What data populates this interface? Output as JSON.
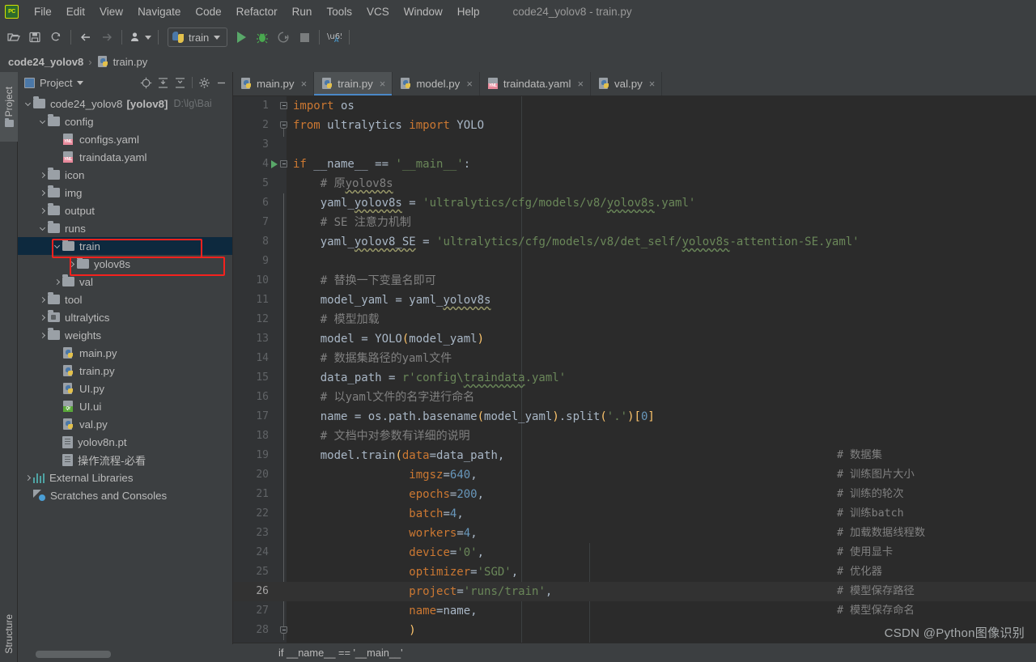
{
  "window": {
    "title": "code24_yolov8 - train.py",
    "logo": "pycharm-logo"
  },
  "menubar": {
    "items": [
      {
        "label": "File"
      },
      {
        "label": "Edit"
      },
      {
        "label": "View"
      },
      {
        "label": "Navigate"
      },
      {
        "label": "Code"
      },
      {
        "label": "Refactor"
      },
      {
        "label": "Run"
      },
      {
        "label": "Tools"
      },
      {
        "label": "VCS"
      },
      {
        "label": "Window"
      },
      {
        "label": "Help"
      }
    ]
  },
  "toolbar": {
    "run_config": "train",
    "icons": [
      "open-folder-icon",
      "save-icon",
      "sync-icon",
      "back-arrow-icon",
      "forward-arrow-icon",
      "profile-icon",
      "run-icon",
      "debug-icon",
      "run-coverage-icon",
      "stop-icon",
      "translate-icon"
    ]
  },
  "navbar": {
    "project": "code24_yolov8",
    "separator": "›",
    "file": "train.py"
  },
  "left_strip": {
    "project_tab": "Project",
    "structure_tab": "Structure"
  },
  "project_panel": {
    "title": "Project",
    "header_icons": [
      "locate-icon",
      "expand-all-icon",
      "collapse-all-icon",
      "gear-icon",
      "hide-icon"
    ],
    "tree": [
      {
        "depth": 0,
        "arrow": "down",
        "icon": "folder",
        "label": "code24_yolov8",
        "bold_suffix": "[yolov8]",
        "path": "D:\\lg\\Bai"
      },
      {
        "depth": 1,
        "arrow": "down",
        "icon": "folder",
        "label": "config"
      },
      {
        "depth": 2,
        "arrow": "none",
        "icon": "yaml",
        "label": "configs.yaml"
      },
      {
        "depth": 2,
        "arrow": "none",
        "icon": "yaml",
        "label": "traindata.yaml"
      },
      {
        "depth": 1,
        "arrow": "right",
        "icon": "folder",
        "label": "icon"
      },
      {
        "depth": 1,
        "arrow": "right",
        "icon": "folder",
        "label": "img"
      },
      {
        "depth": 1,
        "arrow": "right",
        "icon": "folder",
        "label": "output"
      },
      {
        "depth": 1,
        "arrow": "down",
        "icon": "folder",
        "label": "runs"
      },
      {
        "depth": 2,
        "arrow": "down",
        "icon": "folder",
        "label": "train",
        "selected": true,
        "highlight": true
      },
      {
        "depth": 3,
        "arrow": "right",
        "icon": "folder",
        "label": "yolov8s",
        "highlight": true
      },
      {
        "depth": 2,
        "arrow": "right",
        "icon": "folder",
        "label": "val"
      },
      {
        "depth": 1,
        "arrow": "right",
        "icon": "folder",
        "label": "tool"
      },
      {
        "depth": 1,
        "arrow": "right",
        "icon": "module",
        "label": "ultralytics"
      },
      {
        "depth": 1,
        "arrow": "right",
        "icon": "folder",
        "label": "weights"
      },
      {
        "depth": 2,
        "arrow": "none",
        "icon": "py",
        "label": "main.py"
      },
      {
        "depth": 2,
        "arrow": "none",
        "icon": "py",
        "label": "train.py"
      },
      {
        "depth": 2,
        "arrow": "none",
        "icon": "py",
        "label": "UI.py"
      },
      {
        "depth": 2,
        "arrow": "none",
        "icon": "qt",
        "label": "UI.ui"
      },
      {
        "depth": 2,
        "arrow": "none",
        "icon": "py",
        "label": "val.py"
      },
      {
        "depth": 2,
        "arrow": "none",
        "icon": "file",
        "label": "yolov8n.pt"
      },
      {
        "depth": 2,
        "arrow": "none",
        "icon": "file",
        "label": "操作流程-必看"
      },
      {
        "depth": 0,
        "arrow": "right",
        "icon": "lib",
        "label": "External Libraries"
      },
      {
        "depth": 0,
        "arrow": "none",
        "icon": "scratch",
        "label": "Scratches and Consoles"
      }
    ]
  },
  "editor": {
    "tabs": [
      {
        "label": "main.py",
        "icon": "py",
        "active": false
      },
      {
        "label": "train.py",
        "icon": "py",
        "active": true
      },
      {
        "label": "model.py",
        "icon": "py",
        "active": false
      },
      {
        "label": "traindata.yaml",
        "icon": "yaml",
        "active": false
      },
      {
        "label": "val.py",
        "icon": "py",
        "active": false
      }
    ],
    "close_glyph": "×",
    "breadcrumb": "if __name__ == '__main__'",
    "current_line": 26,
    "lines": [
      {
        "n": 1,
        "tokens": [
          {
            "t": "import",
            "c": "kw"
          },
          {
            "t": " os",
            "c": "id"
          }
        ],
        "fold": "open"
      },
      {
        "n": 2,
        "tokens": [
          {
            "t": "from",
            "c": "kw"
          },
          {
            "t": " ultralytics ",
            "c": "id"
          },
          {
            "t": "import",
            "c": "kw"
          },
          {
            "t": " YOLO",
            "c": "id"
          }
        ],
        "fold": "end"
      },
      {
        "n": 3,
        "tokens": []
      },
      {
        "n": 4,
        "tokens": [
          {
            "t": "if",
            "c": "kw"
          },
          {
            "t": " __name__ == ",
            "c": "id"
          },
          {
            "t": "'__main__'",
            "c": "str"
          },
          {
            "t": ":",
            "c": "id"
          }
        ],
        "fold": "open",
        "runmark": true
      },
      {
        "n": 5,
        "tokens": [
          {
            "t": "    # 原",
            "c": "cmt"
          },
          {
            "t": "yolov8s",
            "c": "cmt squig-g"
          }
        ]
      },
      {
        "n": 6,
        "tokens": [
          {
            "t": "    yaml_",
            "c": "id"
          },
          {
            "t": "yolov8s",
            "c": "id squig-g"
          },
          {
            "t": " = ",
            "c": "id"
          },
          {
            "t": "'ultralytics/cfg/models/v8/",
            "c": "str"
          },
          {
            "t": "yolov8s",
            "c": "str squig"
          },
          {
            "t": ".yaml'",
            "c": "str"
          }
        ]
      },
      {
        "n": 7,
        "tokens": [
          {
            "t": "    # SE 注意力机制",
            "c": "cmt"
          }
        ]
      },
      {
        "n": 8,
        "tokens": [
          {
            "t": "    yaml_",
            "c": "id"
          },
          {
            "t": "yolov8_SE",
            "c": "id squig-g"
          },
          {
            "t": " = ",
            "c": "id"
          },
          {
            "t": "'ultralytics/cfg/models/v8/det_self/",
            "c": "str"
          },
          {
            "t": "yolov8s",
            "c": "str squig"
          },
          {
            "t": "-attention-SE.yaml'",
            "c": "str"
          }
        ]
      },
      {
        "n": 9,
        "tokens": []
      },
      {
        "n": 10,
        "tokens": [
          {
            "t": "    # 替换一下变量名即可",
            "c": "cmt"
          }
        ]
      },
      {
        "n": 11,
        "tokens": [
          {
            "t": "    model_yaml = yaml_",
            "c": "id"
          },
          {
            "t": "yolov8s",
            "c": "id squig-g"
          }
        ]
      },
      {
        "n": 12,
        "tokens": [
          {
            "t": "    # 模型加载",
            "c": "cmt"
          }
        ]
      },
      {
        "n": 13,
        "tokens": [
          {
            "t": "    model = YOLO",
            "c": "id"
          },
          {
            "t": "(",
            "c": "fn"
          },
          {
            "t": "model_yaml",
            "c": "id"
          },
          {
            "t": ")",
            "c": "fn"
          }
        ]
      },
      {
        "n": 14,
        "tokens": [
          {
            "t": "    # 数据集路径的yaml文件",
            "c": "cmt"
          }
        ]
      },
      {
        "n": 15,
        "tokens": [
          {
            "t": "    data_path = ",
            "c": "id"
          },
          {
            "t": "r'config\\",
            "c": "str"
          },
          {
            "t": "traindata",
            "c": "str squig"
          },
          {
            "t": ".yaml'",
            "c": "str"
          }
        ]
      },
      {
        "n": 16,
        "tokens": [
          {
            "t": "    # 以yaml文件的名字进行命名",
            "c": "cmt"
          }
        ]
      },
      {
        "n": 17,
        "tokens": [
          {
            "t": "    name = os.path.basename",
            "c": "id"
          },
          {
            "t": "(",
            "c": "fn"
          },
          {
            "t": "model_yaml",
            "c": "id"
          },
          {
            "t": ")",
            "c": "fn"
          },
          {
            "t": ".split",
            "c": "id"
          },
          {
            "t": "(",
            "c": "fn"
          },
          {
            "t": "'.'",
            "c": "str"
          },
          {
            "t": ")",
            "c": "fn"
          },
          {
            "t": "[",
            "c": "fn"
          },
          {
            "t": "0",
            "c": "num2"
          },
          {
            "t": "]",
            "c": "fn"
          }
        ]
      },
      {
        "n": 18,
        "tokens": [
          {
            "t": "    # 文档中对参数有详细的说明",
            "c": "cmt"
          }
        ]
      },
      {
        "n": 19,
        "tokens": [
          {
            "t": "    model.train",
            "c": "id"
          },
          {
            "t": "(",
            "c": "fn"
          },
          {
            "t": "data",
            "c": "kwarg"
          },
          {
            "t": "=data_path",
            "c": "id"
          },
          {
            "t": ",",
            "c": "id"
          }
        ],
        "comment": "# 数据集"
      },
      {
        "n": 20,
        "tokens": [
          {
            "t": "                 ",
            "c": "id"
          },
          {
            "t": "imgsz",
            "c": "kwarg"
          },
          {
            "t": "=",
            "c": "id"
          },
          {
            "t": "640",
            "c": "num2"
          },
          {
            "t": ",",
            "c": "id"
          }
        ],
        "comment": "# 训练图片大小"
      },
      {
        "n": 21,
        "tokens": [
          {
            "t": "                 ",
            "c": "id"
          },
          {
            "t": "epochs",
            "c": "kwarg"
          },
          {
            "t": "=",
            "c": "id"
          },
          {
            "t": "200",
            "c": "num2"
          },
          {
            "t": ",",
            "c": "id"
          }
        ],
        "comment": "# 训练的轮次"
      },
      {
        "n": 22,
        "tokens": [
          {
            "t": "                 ",
            "c": "id"
          },
          {
            "t": "batch",
            "c": "kwarg"
          },
          {
            "t": "=",
            "c": "id"
          },
          {
            "t": "4",
            "c": "num2"
          },
          {
            "t": ",",
            "c": "id"
          }
        ],
        "comment": "# 训练batch"
      },
      {
        "n": 23,
        "tokens": [
          {
            "t": "                 ",
            "c": "id"
          },
          {
            "t": "workers",
            "c": "kwarg"
          },
          {
            "t": "=",
            "c": "id"
          },
          {
            "t": "4",
            "c": "num2"
          },
          {
            "t": ",",
            "c": "id"
          }
        ],
        "comment": "# 加载数据线程数"
      },
      {
        "n": 24,
        "tokens": [
          {
            "t": "                 ",
            "c": "id"
          },
          {
            "t": "device",
            "c": "kwarg"
          },
          {
            "t": "=",
            "c": "id"
          },
          {
            "t": "'0'",
            "c": "str"
          },
          {
            "t": ",",
            "c": "id"
          }
        ],
        "comment": "# 使用显卡"
      },
      {
        "n": 25,
        "tokens": [
          {
            "t": "                 ",
            "c": "id"
          },
          {
            "t": "optimizer",
            "c": "kwarg"
          },
          {
            "t": "=",
            "c": "id"
          },
          {
            "t": "'SGD'",
            "c": "str"
          },
          {
            "t": ",",
            "c": "id"
          }
        ],
        "comment": "# 优化器"
      },
      {
        "n": 26,
        "tokens": [
          {
            "t": "                 ",
            "c": "id"
          },
          {
            "t": "project",
            "c": "kwarg"
          },
          {
            "t": "=",
            "c": "id"
          },
          {
            "t": "'runs/train'",
            "c": "str"
          },
          {
            "t": ",",
            "c": "id"
          }
        ],
        "comment": "# 模型保存路径",
        "current": true
      },
      {
        "n": 27,
        "tokens": [
          {
            "t": "                 ",
            "c": "id"
          },
          {
            "t": "name",
            "c": "kwarg"
          },
          {
            "t": "=name",
            "c": "id"
          },
          {
            "t": ",",
            "c": "id"
          }
        ],
        "comment": "# 模型保存命名"
      },
      {
        "n": 28,
        "tokens": [
          {
            "t": "                 ",
            "c": "id"
          },
          {
            "t": ")",
            "c": "fn"
          }
        ],
        "fold": "end"
      }
    ]
  },
  "watermark": "CSDN @Python图像识别"
}
